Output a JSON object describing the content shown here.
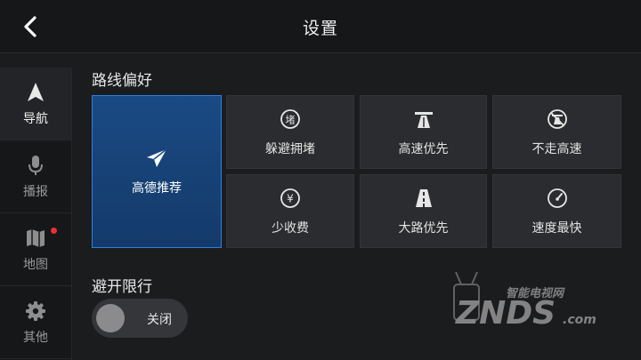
{
  "header": {
    "title": "设置"
  },
  "sidebar": {
    "items": [
      {
        "label": "导航",
        "icon": "navigation-arrow-icon",
        "active": true
      },
      {
        "label": "播报",
        "icon": "microphone-icon",
        "active": false
      },
      {
        "label": "地图",
        "icon": "map-icon",
        "active": false,
        "badge": true
      },
      {
        "label": "其他",
        "icon": "gear-icon",
        "active": false
      }
    ]
  },
  "route_pref": {
    "title": "路线偏好",
    "options": [
      {
        "label": "高德推荐",
        "icon": "paper-plane-icon",
        "selected": true
      },
      {
        "label": "躲避拥堵",
        "icon": "avoid-congestion-icon",
        "icon_text": "堵"
      },
      {
        "label": "高速优先",
        "icon": "highway-icon"
      },
      {
        "label": "不走高速",
        "icon": "no-highway-icon"
      },
      {
        "label": "少收费",
        "icon": "yuan-icon",
        "icon_text": "¥"
      },
      {
        "label": "大路优先",
        "icon": "main-road-icon"
      },
      {
        "label": "速度最快",
        "icon": "speedometer-icon"
      }
    ]
  },
  "restriction": {
    "title": "避开限行",
    "toggle_label": "关闭",
    "enabled": false
  },
  "watermark": {
    "brand": "ZNDS",
    "suffix": ".com",
    "slogan": "智能电视网"
  },
  "colors": {
    "accent": "#2f7fe0",
    "badge": "#e8303a",
    "background": "#1b1c1e"
  }
}
